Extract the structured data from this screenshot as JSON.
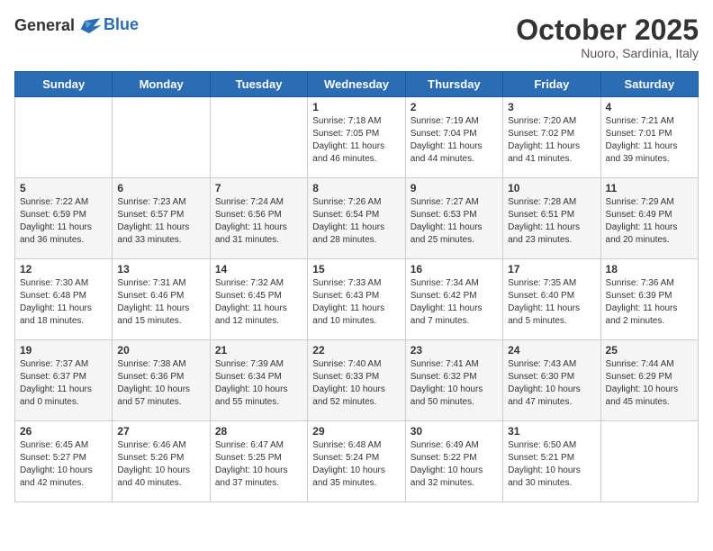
{
  "header": {
    "logo_general": "General",
    "logo_blue": "Blue",
    "month_title": "October 2025",
    "location": "Nuoro, Sardinia, Italy"
  },
  "weekdays": [
    "Sunday",
    "Monday",
    "Tuesday",
    "Wednesday",
    "Thursday",
    "Friday",
    "Saturday"
  ],
  "weeks": [
    {
      "days": [
        {
          "num": "",
          "info": ""
        },
        {
          "num": "",
          "info": ""
        },
        {
          "num": "",
          "info": ""
        },
        {
          "num": "1",
          "info": "Sunrise: 7:18 AM\nSunset: 7:05 PM\nDaylight: 11 hours and 46 minutes."
        },
        {
          "num": "2",
          "info": "Sunrise: 7:19 AM\nSunset: 7:04 PM\nDaylight: 11 hours and 44 minutes."
        },
        {
          "num": "3",
          "info": "Sunrise: 7:20 AM\nSunset: 7:02 PM\nDaylight: 11 hours and 41 minutes."
        },
        {
          "num": "4",
          "info": "Sunrise: 7:21 AM\nSunset: 7:01 PM\nDaylight: 11 hours and 39 minutes."
        }
      ]
    },
    {
      "days": [
        {
          "num": "5",
          "info": "Sunrise: 7:22 AM\nSunset: 6:59 PM\nDaylight: 11 hours and 36 minutes."
        },
        {
          "num": "6",
          "info": "Sunrise: 7:23 AM\nSunset: 6:57 PM\nDaylight: 11 hours and 33 minutes."
        },
        {
          "num": "7",
          "info": "Sunrise: 7:24 AM\nSunset: 6:56 PM\nDaylight: 11 hours and 31 minutes."
        },
        {
          "num": "8",
          "info": "Sunrise: 7:26 AM\nSunset: 6:54 PM\nDaylight: 11 hours and 28 minutes."
        },
        {
          "num": "9",
          "info": "Sunrise: 7:27 AM\nSunset: 6:53 PM\nDaylight: 11 hours and 25 minutes."
        },
        {
          "num": "10",
          "info": "Sunrise: 7:28 AM\nSunset: 6:51 PM\nDaylight: 11 hours and 23 minutes."
        },
        {
          "num": "11",
          "info": "Sunrise: 7:29 AM\nSunset: 6:49 PM\nDaylight: 11 hours and 20 minutes."
        }
      ]
    },
    {
      "days": [
        {
          "num": "12",
          "info": "Sunrise: 7:30 AM\nSunset: 6:48 PM\nDaylight: 11 hours and 18 minutes."
        },
        {
          "num": "13",
          "info": "Sunrise: 7:31 AM\nSunset: 6:46 PM\nDaylight: 11 hours and 15 minutes."
        },
        {
          "num": "14",
          "info": "Sunrise: 7:32 AM\nSunset: 6:45 PM\nDaylight: 11 hours and 12 minutes."
        },
        {
          "num": "15",
          "info": "Sunrise: 7:33 AM\nSunset: 6:43 PM\nDaylight: 11 hours and 10 minutes."
        },
        {
          "num": "16",
          "info": "Sunrise: 7:34 AM\nSunset: 6:42 PM\nDaylight: 11 hours and 7 minutes."
        },
        {
          "num": "17",
          "info": "Sunrise: 7:35 AM\nSunset: 6:40 PM\nDaylight: 11 hours and 5 minutes."
        },
        {
          "num": "18",
          "info": "Sunrise: 7:36 AM\nSunset: 6:39 PM\nDaylight: 11 hours and 2 minutes."
        }
      ]
    },
    {
      "days": [
        {
          "num": "19",
          "info": "Sunrise: 7:37 AM\nSunset: 6:37 PM\nDaylight: 11 hours and 0 minutes."
        },
        {
          "num": "20",
          "info": "Sunrise: 7:38 AM\nSunset: 6:36 PM\nDaylight: 10 hours and 57 minutes."
        },
        {
          "num": "21",
          "info": "Sunrise: 7:39 AM\nSunset: 6:34 PM\nDaylight: 10 hours and 55 minutes."
        },
        {
          "num": "22",
          "info": "Sunrise: 7:40 AM\nSunset: 6:33 PM\nDaylight: 10 hours and 52 minutes."
        },
        {
          "num": "23",
          "info": "Sunrise: 7:41 AM\nSunset: 6:32 PM\nDaylight: 10 hours and 50 minutes."
        },
        {
          "num": "24",
          "info": "Sunrise: 7:43 AM\nSunset: 6:30 PM\nDaylight: 10 hours and 47 minutes."
        },
        {
          "num": "25",
          "info": "Sunrise: 7:44 AM\nSunset: 6:29 PM\nDaylight: 10 hours and 45 minutes."
        }
      ]
    },
    {
      "days": [
        {
          "num": "26",
          "info": "Sunrise: 6:45 AM\nSunset: 5:27 PM\nDaylight: 10 hours and 42 minutes."
        },
        {
          "num": "27",
          "info": "Sunrise: 6:46 AM\nSunset: 5:26 PM\nDaylight: 10 hours and 40 minutes."
        },
        {
          "num": "28",
          "info": "Sunrise: 6:47 AM\nSunset: 5:25 PM\nDaylight: 10 hours and 37 minutes."
        },
        {
          "num": "29",
          "info": "Sunrise: 6:48 AM\nSunset: 5:24 PM\nDaylight: 10 hours and 35 minutes."
        },
        {
          "num": "30",
          "info": "Sunrise: 6:49 AM\nSunset: 5:22 PM\nDaylight: 10 hours and 32 minutes."
        },
        {
          "num": "31",
          "info": "Sunrise: 6:50 AM\nSunset: 5:21 PM\nDaylight: 10 hours and 30 minutes."
        },
        {
          "num": "",
          "info": ""
        }
      ]
    }
  ]
}
